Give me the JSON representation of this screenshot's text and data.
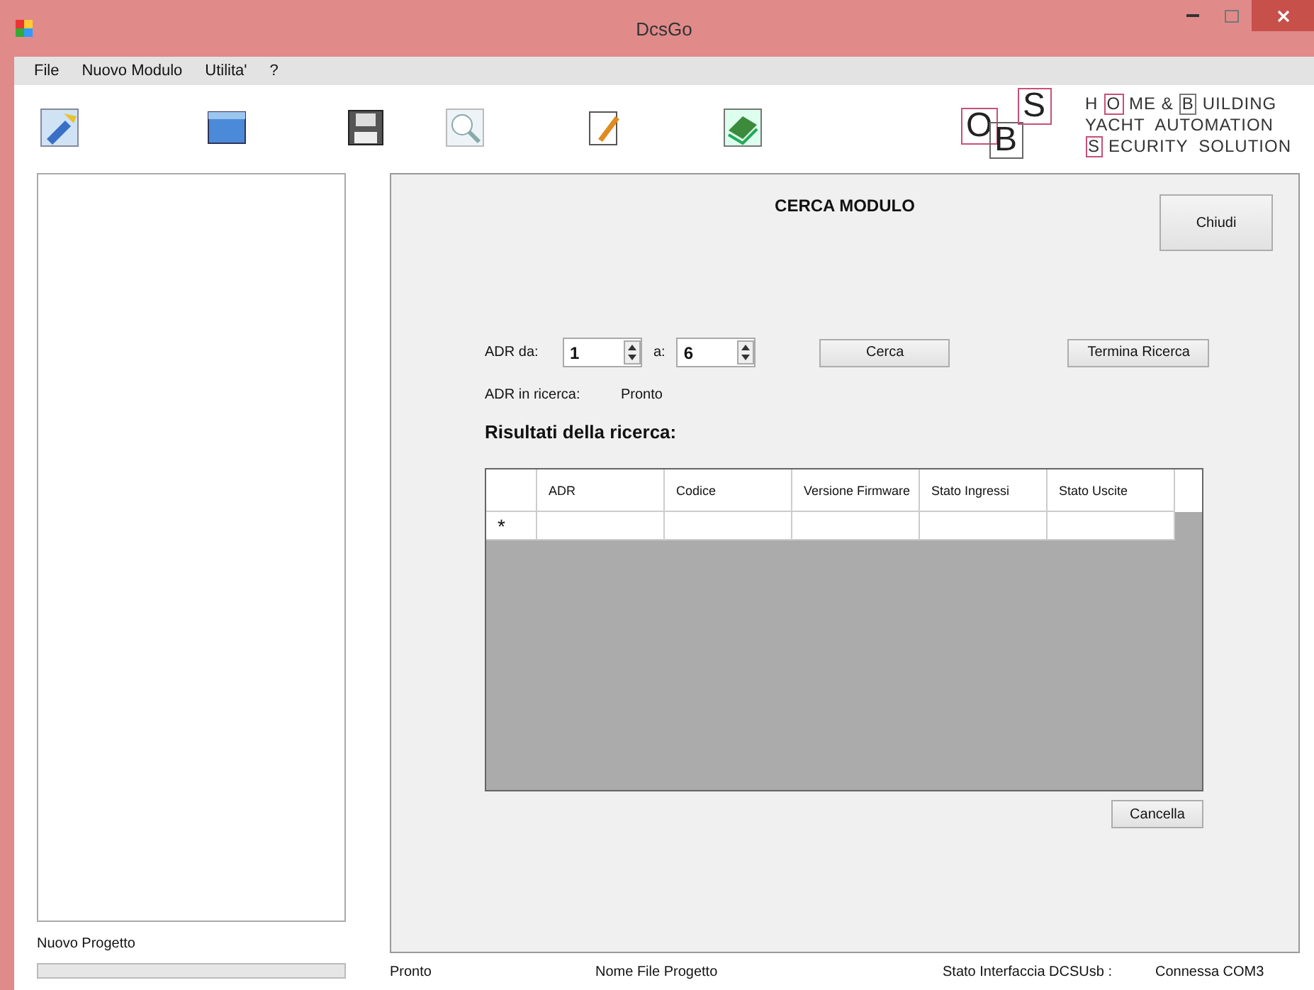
{
  "window": {
    "title": "DcsGo"
  },
  "menu": [
    {
      "label": "File"
    },
    {
      "label": "Nuovo Modulo"
    },
    {
      "label": "Utilita'"
    },
    {
      "label": "?"
    }
  ],
  "toolbar": [
    {
      "kind": "wrench"
    },
    {
      "kind": "folder"
    },
    {
      "kind": "save"
    },
    {
      "kind": "search"
    },
    {
      "kind": "edit"
    },
    {
      "kind": "board"
    }
  ],
  "logo": {
    "letters": [
      {
        "text": "O",
        "color": "#c8507a"
      },
      {
        "text": "B",
        "color": "#666666"
      },
      {
        "text": "S",
        "color": "#c8507a"
      }
    ],
    "lines": [
      [
        {
          "kind": "plain",
          "text": "H"
        },
        {
          "kind": "boxed",
          "text": "O",
          "color": "#c8507a"
        },
        {
          "kind": "plain",
          "text": "ME &"
        },
        {
          "kind": "boxed",
          "text": "B",
          "color": "#777777"
        },
        {
          "kind": "plain",
          "text": "UILDING"
        }
      ],
      [
        {
          "kind": "plain",
          "text": "YACHT  AUTOMATION"
        }
      ],
      [
        {
          "kind": "boxed",
          "text": "S",
          "color": "#c8507a"
        },
        {
          "kind": "plain",
          "text": "ECURITY  SOLUTION"
        }
      ]
    ]
  },
  "sidebar": {
    "label": "Nuovo Progetto"
  },
  "search": {
    "title": "CERCA MODULO",
    "close": "Chiudi",
    "from_label": "ADR da:",
    "from": "1",
    "to_label": "a:",
    "to": "6",
    "search_button": "Cerca",
    "stop_button": "Termina Ricerca",
    "current_label": "ADR in ricerca:",
    "current_value": "Pronto",
    "results_title": "Risultati della ricerca:",
    "table": {
      "columns": [
        "ADR",
        "Codice",
        "Versione Firmware",
        "Stato Ingressi",
        "Stato Uscite"
      ],
      "new_row_marker": "*"
    },
    "clear_button": "Cancella"
  },
  "status_bar": [
    "Pronto",
    "Nome File Progetto",
    "Stato Interfaccia DCSUsb :",
    "Connessa COM3"
  ]
}
